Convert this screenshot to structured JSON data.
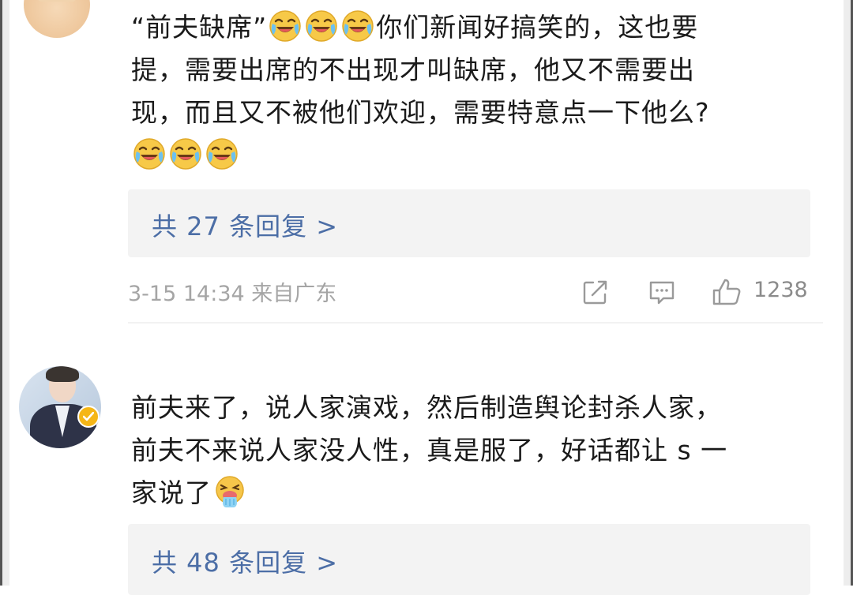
{
  "comments": [
    {
      "text_parts": {
        "a": "“前夫缺席”",
        "b": "你们新闻好搞笑的，这也要",
        "c": "提，需要出席的不出现才叫缺席，他又不需要出",
        "d": "现，而且又不被他们欢迎，需要特意点一下他么?"
      },
      "emoji": "laughing-crying-emoji",
      "replies_label": "共 27 条回复 >",
      "timestamp": "3-15 14:34 来自广东",
      "likes": "1238"
    },
    {
      "text_parts": {
        "a": "前夫来了，说人家演戏，然后制造舆论封杀人家，",
        "b": "前夫不来说人家没人性，真是服了，好话都让 s 一",
        "c": "家说了"
      },
      "emoji": "vomiting-emoji",
      "replies_label": "共 48 条回复 >",
      "verified": true
    }
  ],
  "colors": {
    "link": "#4c6ea6",
    "meta": "#a5a5a5",
    "reply_bg": "#f3f3f3",
    "badge": "#f5b617"
  },
  "icons": [
    "share-icon",
    "comment-icon",
    "thumbs-up-icon",
    "verified-icon"
  ]
}
